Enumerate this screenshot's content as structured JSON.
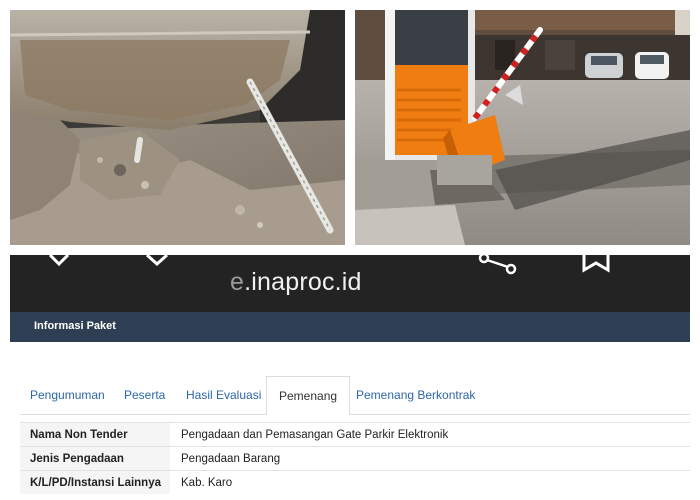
{
  "app": {
    "domain": "e.inaproc.id",
    "domain_prefix": "e",
    "domain_rest": ".inaproc.id"
  },
  "panel": {
    "title": "Informasi Paket"
  },
  "tabs": [
    {
      "label": "Pengumuman",
      "active": false
    },
    {
      "label": "Peserta",
      "active": false
    },
    {
      "label": "Hasil Evaluasi",
      "active": false
    },
    {
      "label": "Pemenang",
      "active": true
    },
    {
      "label": "Pemenang Berkontrak",
      "active": false
    }
  ],
  "info_rows": [
    {
      "label": "Nama Non Tender",
      "value": "Pengadaan dan Pemasangan Gate Parkir Elektronik"
    },
    {
      "label": "Jenis Pengadaan",
      "value": "Pengadaan Barang"
    },
    {
      "label": "K/L/PD/Instansi Lainnya",
      "value": "Kab. Karo"
    }
  ],
  "icons": {
    "close": "close-icon",
    "chevron": "chevron-down-icon",
    "share": "share-icon",
    "bookmark": "bookmark-icon"
  },
  "colors": {
    "appbar": "#232323",
    "panel_header": "#2f3f53",
    "link": "#2d67a8",
    "gate_orange": "#f07d12"
  }
}
